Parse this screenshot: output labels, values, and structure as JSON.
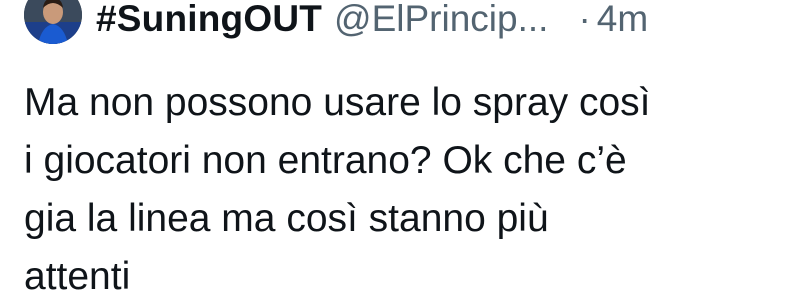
{
  "tweet": {
    "author": {
      "display_name": "#SuningOUT",
      "handle": "@ElPrincip...",
      "avatar": "avatar-image"
    },
    "separator": "·",
    "timestamp": "4m",
    "text": "Ma non possono usare lo spray così\ni giocatori non entrano? Ok che c’è\ngia la linea ma così stanno più\nattenti"
  }
}
